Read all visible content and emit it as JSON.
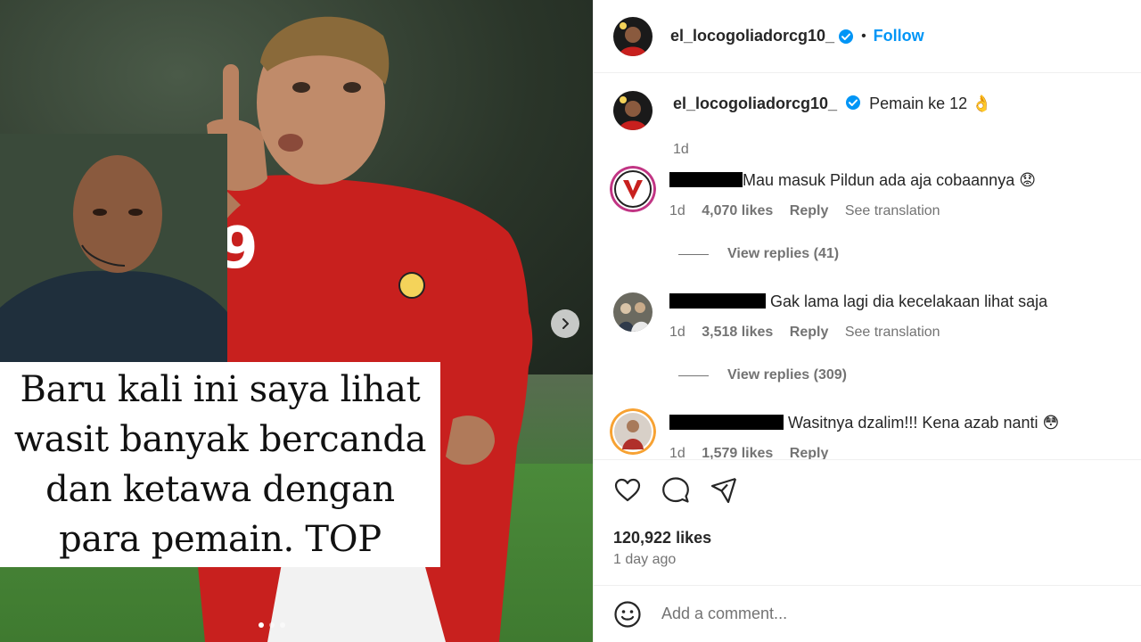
{
  "media": {
    "overlay_text": "Baru kali ini saya lihat wasit banyak bercanda dan ketawa dengan para pemain. TOP",
    "next_icon": "chevron-right-icon",
    "dots_count": 3,
    "active_dot": 0
  },
  "header": {
    "username": "el_locogoliadorcg10_",
    "verified_icon": "verified-badge-icon",
    "separator": "•",
    "follow_label": "Follow"
  },
  "caption": {
    "username": "el_locogoliadorcg10_",
    "text": "Pemain ke 12 👌",
    "time": "1d"
  },
  "comments": [
    {
      "text": "Mau masuk Pildun ada aja cobaannya 😟",
      "time": "1d",
      "likes": "4,070 likes",
      "reply_label": "Reply",
      "translate_label": "See translation",
      "view_replies": "View replies (41)"
    },
    {
      "text": " Gak lama lagi dia kecelakaan lihat saja",
      "time": "1d",
      "likes": "3,518 likes",
      "reply_label": "Reply",
      "translate_label": "See translation",
      "view_replies": "View replies (309)"
    },
    {
      "text": " Wasitnya dzalim!!! Kena azab nanti 😳",
      "time": "1d",
      "likes": "1,579 likes",
      "reply_label": "Reply"
    }
  ],
  "actions": {
    "like_icon": "heart-icon",
    "comment_icon": "comment-bubble-icon",
    "share_icon": "paper-plane-icon",
    "likes": "120,922 likes",
    "posted": "1 day ago"
  },
  "add_comment": {
    "emoji_icon": "smiley-icon",
    "placeholder": "Add a comment..."
  },
  "colors": {
    "link_blue": "#0095f6",
    "muted_text": "#737373",
    "jersey_red": "#c8201e"
  }
}
